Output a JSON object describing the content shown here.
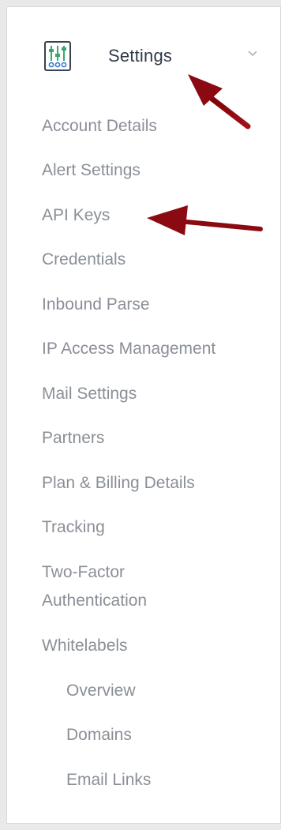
{
  "header": {
    "title": "Settings",
    "icon": "settings-sliders-icon",
    "chevron": "chevron-down-icon"
  },
  "menu": {
    "items": [
      {
        "label": "Account Details"
      },
      {
        "label": "Alert Settings"
      },
      {
        "label": "API Keys"
      },
      {
        "label": "Credentials"
      },
      {
        "label": "Inbound Parse"
      },
      {
        "label": "IP Access Management"
      },
      {
        "label": "Mail Settings"
      },
      {
        "label": "Partners"
      },
      {
        "label": "Plan & Billing Details"
      },
      {
        "label": "Tracking"
      },
      {
        "label": "Two-Factor Authentication"
      },
      {
        "label": "Whitelabels"
      }
    ],
    "subitems": [
      {
        "label": "Overview"
      },
      {
        "label": "Domains"
      },
      {
        "label": "Email Links"
      }
    ]
  },
  "annotations": {
    "arrow_color": "#8b0a12"
  }
}
